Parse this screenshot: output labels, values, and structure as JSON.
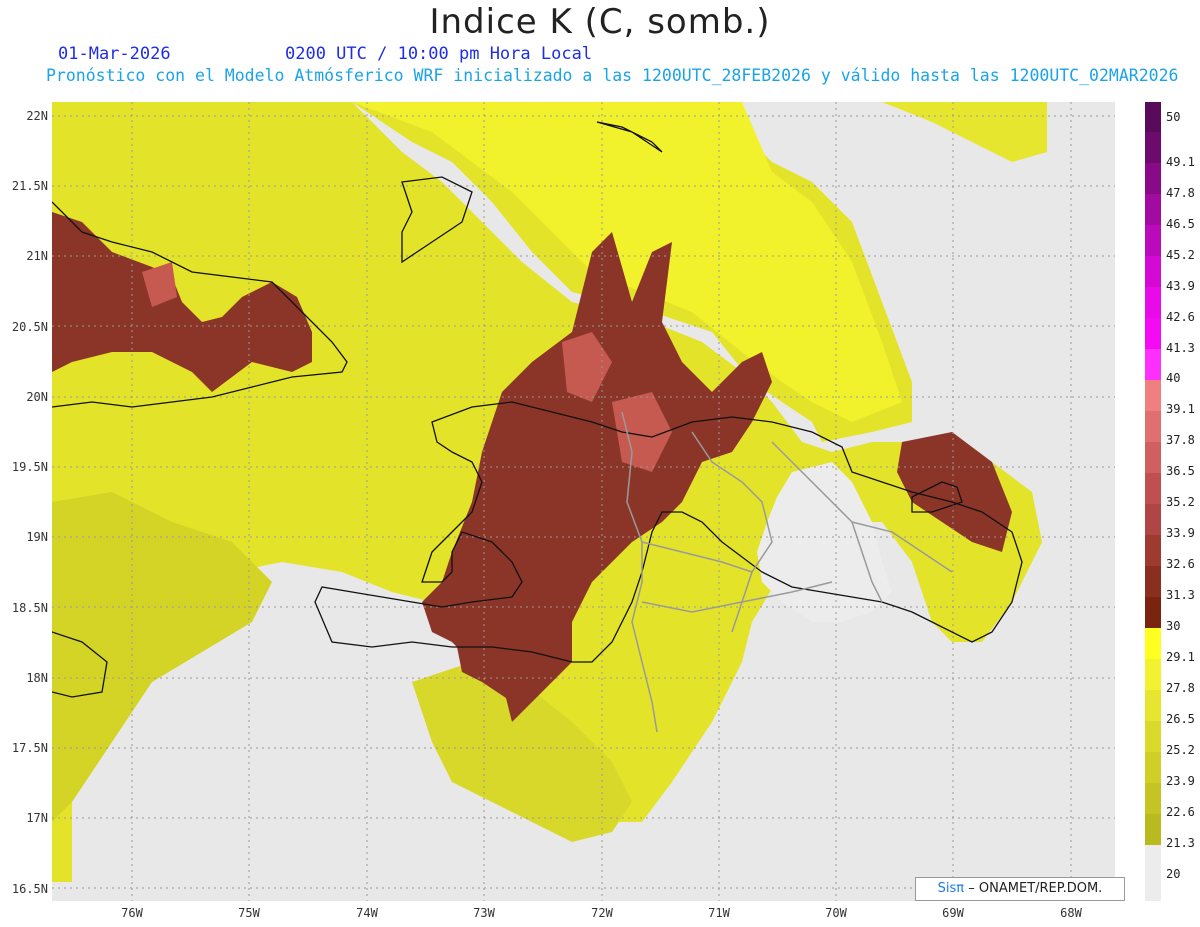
{
  "header": {
    "title": "Indice K (C, somb.)",
    "date": "01-Mar-2026",
    "time": "0200 UTC / 10:00 pm Hora Local",
    "forecast_line": "Pronóstico con el Modelo Atmósferico WRF inicializado a las 1200UTC_28FEB2026 y válido hasta las  1200UTC_02MAR2026"
  },
  "map": {
    "lat_labels": [
      "22N",
      "21.5N",
      "21N",
      "20.5N",
      "20N",
      "19.5N",
      "19N",
      "18.5N",
      "18N",
      "17.5N",
      "17N",
      "16.5N"
    ],
    "lon_labels": [
      "76W",
      "75W",
      "74W",
      "73W",
      "72W",
      "71W",
      "70W",
      "69W",
      "68W"
    ],
    "background_color": "#e8e8e8"
  },
  "colorbar": {
    "labels": [
      "50",
      "49.1",
      "47.8",
      "46.5",
      "45.2",
      "43.9",
      "42.6",
      "41.3",
      "40",
      "39.1",
      "37.8",
      "36.5",
      "35.2",
      "33.9",
      "32.6",
      "31.3",
      "30",
      "29.1",
      "27.8",
      "26.5",
      "25.2",
      "23.9",
      "22.6",
      "21.3",
      "20"
    ],
    "colors": [
      "#5a0a5a",
      "#6e0a6e",
      "#880a88",
      "#a20aa2",
      "#bb0abb",
      "#d40ad4",
      "#e80ae8",
      "#f50af5",
      "#ff30ff",
      "#f08080",
      "#e07070",
      "#d06060",
      "#c05050",
      "#b04545",
      "#9e3a30",
      "#8a2e20",
      "#7a2410",
      "#ffff22",
      "#f2f230",
      "#e6e630",
      "#dada2c",
      "#cfcf28",
      "#c4c424",
      "#b9b920",
      "#ececec"
    ]
  },
  "credit": {
    "logo": "Sisπ",
    "text": "– ONAMET/REP.DOM."
  }
}
